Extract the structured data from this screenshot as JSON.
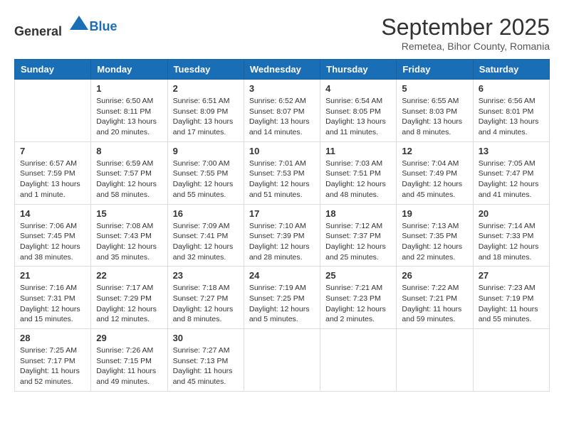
{
  "header": {
    "logo_general": "General",
    "logo_blue": "Blue",
    "month": "September 2025",
    "location": "Remetea, Bihor County, Romania"
  },
  "days_of_week": [
    "Sunday",
    "Monday",
    "Tuesday",
    "Wednesday",
    "Thursday",
    "Friday",
    "Saturday"
  ],
  "weeks": [
    [
      {
        "day": "",
        "info": ""
      },
      {
        "day": "1",
        "info": "Sunrise: 6:50 AM\nSunset: 8:11 PM\nDaylight: 13 hours\nand 20 minutes."
      },
      {
        "day": "2",
        "info": "Sunrise: 6:51 AM\nSunset: 8:09 PM\nDaylight: 13 hours\nand 17 minutes."
      },
      {
        "day": "3",
        "info": "Sunrise: 6:52 AM\nSunset: 8:07 PM\nDaylight: 13 hours\nand 14 minutes."
      },
      {
        "day": "4",
        "info": "Sunrise: 6:54 AM\nSunset: 8:05 PM\nDaylight: 13 hours\nand 11 minutes."
      },
      {
        "day": "5",
        "info": "Sunrise: 6:55 AM\nSunset: 8:03 PM\nDaylight: 13 hours\nand 8 minutes."
      },
      {
        "day": "6",
        "info": "Sunrise: 6:56 AM\nSunset: 8:01 PM\nDaylight: 13 hours\nand 4 minutes."
      }
    ],
    [
      {
        "day": "7",
        "info": "Sunrise: 6:57 AM\nSunset: 7:59 PM\nDaylight: 13 hours\nand 1 minute."
      },
      {
        "day": "8",
        "info": "Sunrise: 6:59 AM\nSunset: 7:57 PM\nDaylight: 12 hours\nand 58 minutes."
      },
      {
        "day": "9",
        "info": "Sunrise: 7:00 AM\nSunset: 7:55 PM\nDaylight: 12 hours\nand 55 minutes."
      },
      {
        "day": "10",
        "info": "Sunrise: 7:01 AM\nSunset: 7:53 PM\nDaylight: 12 hours\nand 51 minutes."
      },
      {
        "day": "11",
        "info": "Sunrise: 7:03 AM\nSunset: 7:51 PM\nDaylight: 12 hours\nand 48 minutes."
      },
      {
        "day": "12",
        "info": "Sunrise: 7:04 AM\nSunset: 7:49 PM\nDaylight: 12 hours\nand 45 minutes."
      },
      {
        "day": "13",
        "info": "Sunrise: 7:05 AM\nSunset: 7:47 PM\nDaylight: 12 hours\nand 41 minutes."
      }
    ],
    [
      {
        "day": "14",
        "info": "Sunrise: 7:06 AM\nSunset: 7:45 PM\nDaylight: 12 hours\nand 38 minutes."
      },
      {
        "day": "15",
        "info": "Sunrise: 7:08 AM\nSunset: 7:43 PM\nDaylight: 12 hours\nand 35 minutes."
      },
      {
        "day": "16",
        "info": "Sunrise: 7:09 AM\nSunset: 7:41 PM\nDaylight: 12 hours\nand 32 minutes."
      },
      {
        "day": "17",
        "info": "Sunrise: 7:10 AM\nSunset: 7:39 PM\nDaylight: 12 hours\nand 28 minutes."
      },
      {
        "day": "18",
        "info": "Sunrise: 7:12 AM\nSunset: 7:37 PM\nDaylight: 12 hours\nand 25 minutes."
      },
      {
        "day": "19",
        "info": "Sunrise: 7:13 AM\nSunset: 7:35 PM\nDaylight: 12 hours\nand 22 minutes."
      },
      {
        "day": "20",
        "info": "Sunrise: 7:14 AM\nSunset: 7:33 PM\nDaylight: 12 hours\nand 18 minutes."
      }
    ],
    [
      {
        "day": "21",
        "info": "Sunrise: 7:16 AM\nSunset: 7:31 PM\nDaylight: 12 hours\nand 15 minutes."
      },
      {
        "day": "22",
        "info": "Sunrise: 7:17 AM\nSunset: 7:29 PM\nDaylight: 12 hours\nand 12 minutes."
      },
      {
        "day": "23",
        "info": "Sunrise: 7:18 AM\nSunset: 7:27 PM\nDaylight: 12 hours\nand 8 minutes."
      },
      {
        "day": "24",
        "info": "Sunrise: 7:19 AM\nSunset: 7:25 PM\nDaylight: 12 hours\nand 5 minutes."
      },
      {
        "day": "25",
        "info": "Sunrise: 7:21 AM\nSunset: 7:23 PM\nDaylight: 12 hours\nand 2 minutes."
      },
      {
        "day": "26",
        "info": "Sunrise: 7:22 AM\nSunset: 7:21 PM\nDaylight: 11 hours\nand 59 minutes."
      },
      {
        "day": "27",
        "info": "Sunrise: 7:23 AM\nSunset: 7:19 PM\nDaylight: 11 hours\nand 55 minutes."
      }
    ],
    [
      {
        "day": "28",
        "info": "Sunrise: 7:25 AM\nSunset: 7:17 PM\nDaylight: 11 hours\nand 52 minutes."
      },
      {
        "day": "29",
        "info": "Sunrise: 7:26 AM\nSunset: 7:15 PM\nDaylight: 11 hours\nand 49 minutes."
      },
      {
        "day": "30",
        "info": "Sunrise: 7:27 AM\nSunset: 7:13 PM\nDaylight: 11 hours\nand 45 minutes."
      },
      {
        "day": "",
        "info": ""
      },
      {
        "day": "",
        "info": ""
      },
      {
        "day": "",
        "info": ""
      },
      {
        "day": "",
        "info": ""
      }
    ]
  ]
}
